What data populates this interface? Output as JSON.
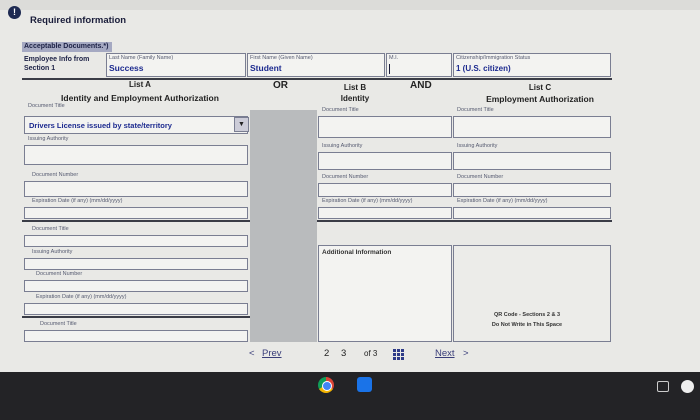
{
  "form": {
    "title": "Required information",
    "acceptable_documents": "Acceptable Documents.*)",
    "employee_label_1": "Employee Info from",
    "employee_label_2": "Section 1",
    "last_name_label": "Last Name (Family Name)",
    "last_name_value": "Success",
    "first_name_label": "First Name (Given Name)",
    "first_name_value": "Student",
    "mi_label": "M.I.",
    "citizenship_label": "Citizenship/Immigration Status",
    "citizenship_value": "1 (U.S. citizen)"
  },
  "lists": {
    "list_a": {
      "heading": "List A",
      "subheading": "Identity and Employment Authorization"
    },
    "or": "OR",
    "list_b": {
      "heading": "List B",
      "subheading": "Identity"
    },
    "and": "AND",
    "list_c": {
      "heading": "List C",
      "subheading": "Employment Authorization"
    }
  },
  "labels": {
    "document_title": "Document Title",
    "issuing_authority": "Issuing Authority",
    "document_number": "Document Number",
    "expiration_date": "Expiration Date (if any) (mm/dd/yyyy)"
  },
  "list_a_doc": {
    "selected": "Drivers License issued by state/territory",
    "dropdown_arrow": "▼"
  },
  "additional_information": "Additional Information",
  "qr": {
    "line1": "QR Code - Sections 2 & 3",
    "line2": "Do Not Write in This Space"
  },
  "pagination": {
    "prev_label": "Prev",
    "prev_arrow": "<",
    "next_label": "Next",
    "next_arrow": ">",
    "page_2": "2",
    "page_3": "3",
    "of_label": "of 3"
  },
  "colors": {
    "accent_blue": "#1c2a8f",
    "header_band": "#a5a9c2",
    "taskbar": "#232326"
  },
  "icons": {
    "info": "info-icon",
    "chrome": "chrome-icon",
    "files": "files-icon",
    "grid": "grid-icon"
  },
  "info_icon_glyph": "!"
}
